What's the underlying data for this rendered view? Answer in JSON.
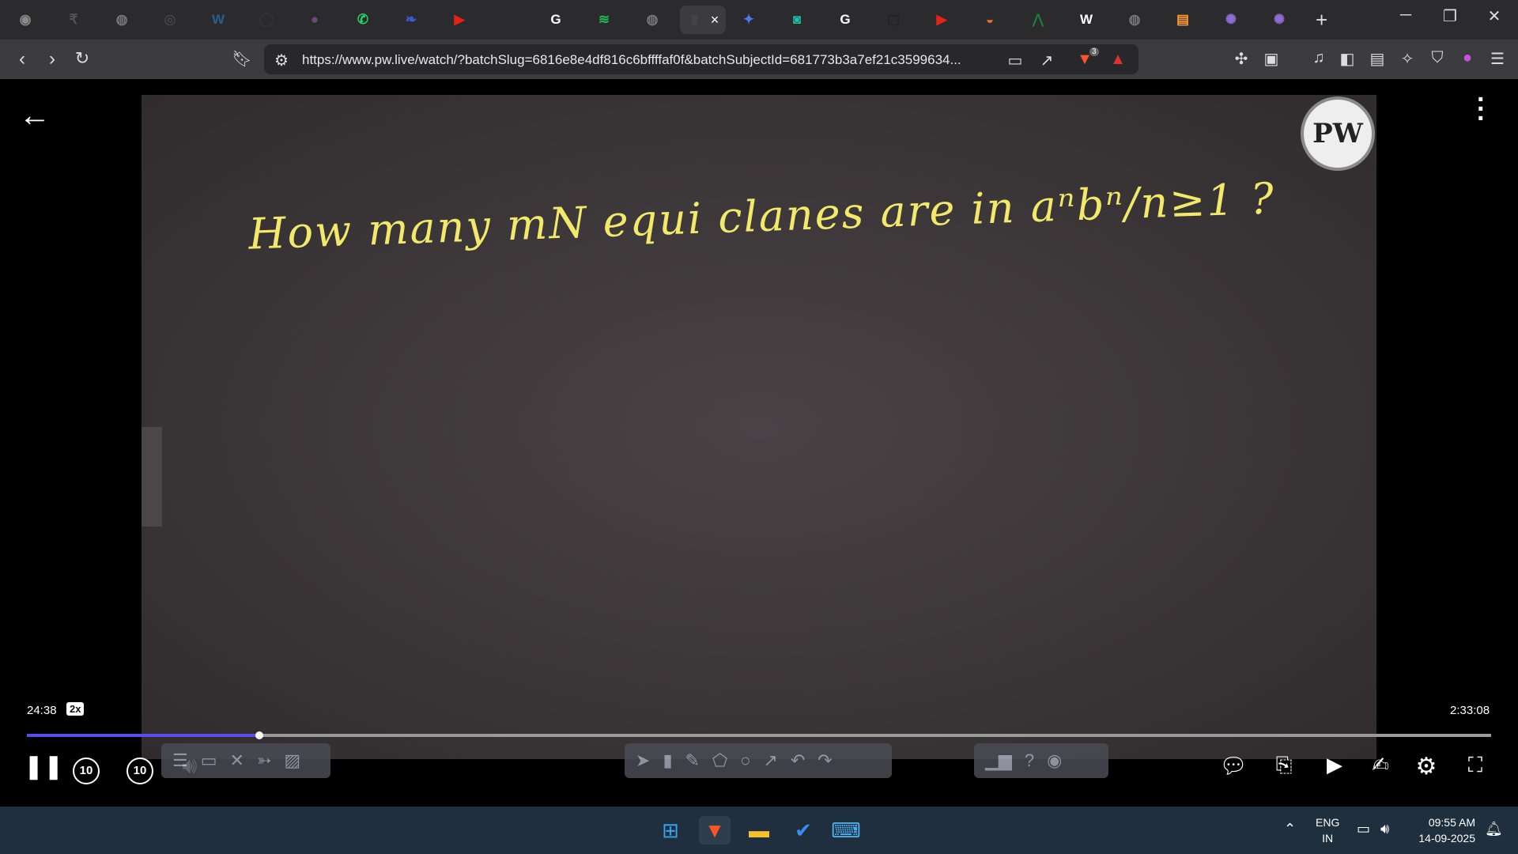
{
  "browser": {
    "tabs": [
      {
        "icon": "chat-icon",
        "color": "#8a8a8a"
      },
      {
        "icon": "rupee-icon",
        "color": "#555"
      },
      {
        "icon": "globe-icon",
        "color": "#777"
      },
      {
        "icon": "circle-logo-icon",
        "color": "#444"
      },
      {
        "icon": "w3-icon",
        "color": "#2b5d8a"
      },
      {
        "icon": "ring-icon",
        "color": "#333"
      },
      {
        "icon": "orb-icon",
        "color": "#6b4a7a"
      },
      {
        "icon": "whatsapp-icon",
        "color": "#25d366"
      },
      {
        "icon": "feather-icon",
        "color": "#3b5bdb"
      },
      {
        "icon": "youtube-icon",
        "color": "#e62117"
      },
      {
        "icon": "gfg-icon",
        "color": "#333"
      },
      {
        "icon": "google-icon",
        "color": "#fff"
      },
      {
        "icon": "spotify-icon",
        "color": "#1db954"
      },
      {
        "icon": "globe-icon",
        "color": "#777"
      },
      {
        "icon": "pw-tab-icon",
        "color": "#444",
        "active": true
      },
      {
        "icon": "gemini-icon",
        "color": "#4a7cf0"
      },
      {
        "icon": "circle-g-icon",
        "color": "#19c3a8"
      },
      {
        "icon": "google-icon",
        "color": "#fff"
      },
      {
        "icon": "screen-icon",
        "color": "#222"
      },
      {
        "icon": "youtube-icon",
        "color": "#e62117"
      },
      {
        "icon": "ball-icon",
        "color": "#e8712a"
      },
      {
        "icon": "chart-icon",
        "color": "#1a7f3a"
      },
      {
        "icon": "wikipedia-icon",
        "color": "#fff"
      },
      {
        "icon": "globe-icon",
        "color": "#777"
      },
      {
        "icon": "india-flag-icon",
        "color": "#ff9933"
      },
      {
        "icon": "sun-icon",
        "color": "#8e6bd6"
      },
      {
        "icon": "sun-icon",
        "color": "#8e6bd6"
      }
    ],
    "active_tab_close": "×",
    "new_tab": "+",
    "url": "https://www.pw.live/watch/?batchSlug=6816e8e4df816c6bffffaf0f&batchSubjectId=681773b3a7ef21c3599634...",
    "shield_badge": "3"
  },
  "player": {
    "board_text": "How many mN equi clanes are in aⁿbⁿ/n≥1 ?",
    "logo_text": "PW",
    "elapsed": "24:38",
    "speed": "2x",
    "duration": "2:33:08",
    "progress_fraction": 0.159,
    "rewind_label": "10",
    "forward_label": "10"
  },
  "taskbar": {
    "lang_line1": "ENG",
    "lang_line2": "IN",
    "time": "09:55 AM",
    "date": "14-09-2025"
  },
  "colors": {
    "board_ink": "#f2e86a",
    "progress": "#5a4df0",
    "taskbar": "#1f2f3d"
  }
}
